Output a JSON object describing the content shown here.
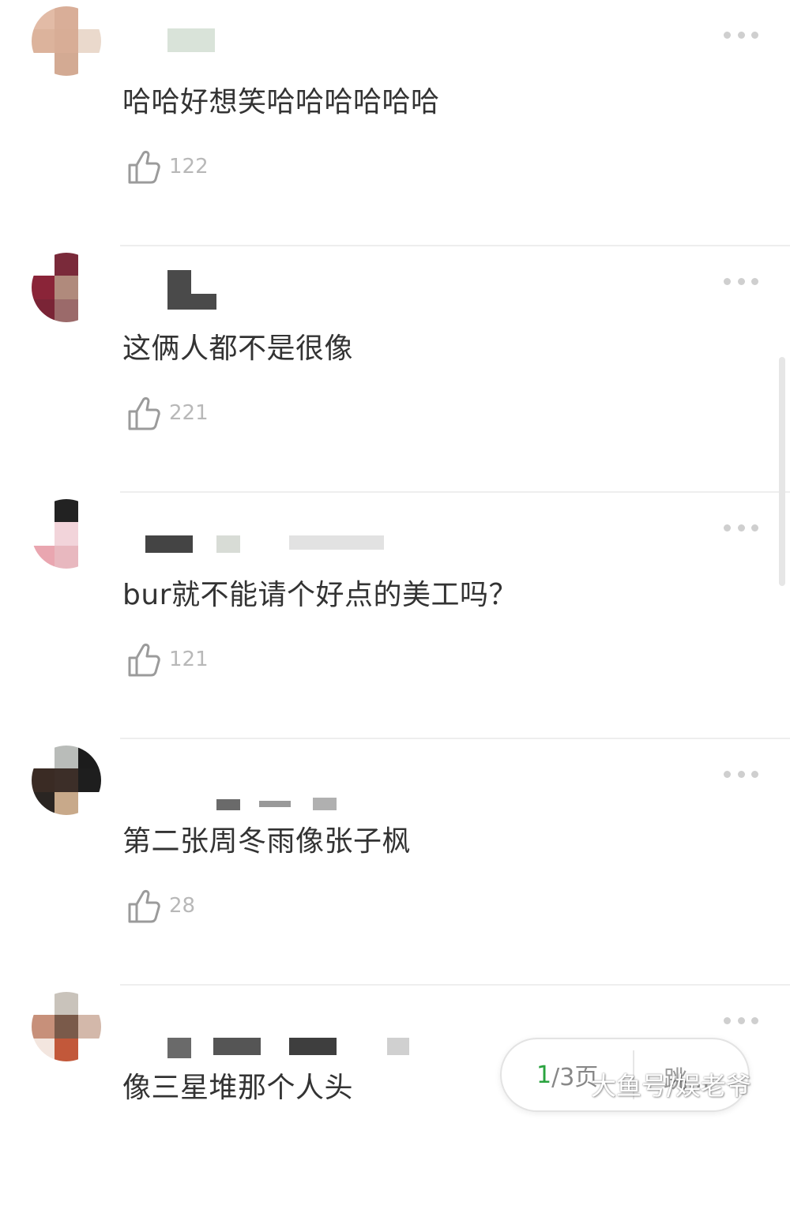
{
  "comments": [
    {
      "text": "哈哈好想笑哈哈哈哈哈哈",
      "likes": "122"
    },
    {
      "text": "这俩人都不是很像",
      "likes": "221"
    },
    {
      "text": "bur就不能请个好点的美工吗？",
      "likes": "121"
    },
    {
      "text": "第二张周冬雨像张子枫",
      "likes": "28"
    },
    {
      "text": "像三星堆那个人头",
      "likes": ""
    }
  ],
  "pager": {
    "current": "1",
    "total": "/3页",
    "jump": "跳..."
  },
  "watermark": "大鱼号/娱老爷",
  "icons": {
    "like": "thumbs-up-icon",
    "more": "more-dots-icon"
  },
  "colors": {
    "text": "#333333",
    "muted": "#b8b8b8",
    "accent": "#2aa33f"
  }
}
